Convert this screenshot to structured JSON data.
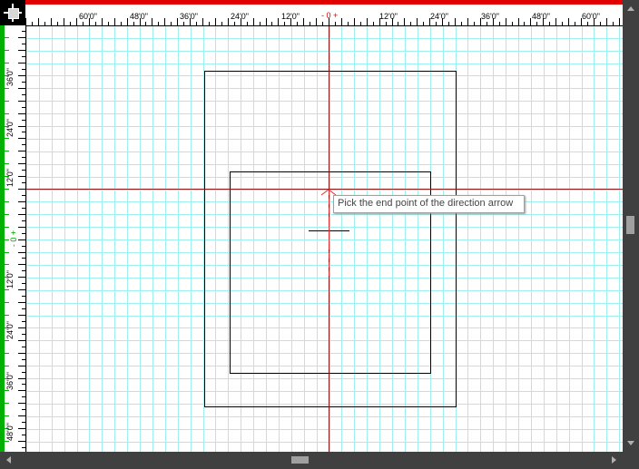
{
  "rulers": {
    "horizontal_labels": [
      "60'0\"",
      "48'0\"",
      "36'0\"",
      "24'0\"",
      "12'0\"",
      "0",
      "12'0\"",
      "24'0\"",
      "36'0\"",
      "48'0\"",
      "60'0\""
    ],
    "vertical_labels": [
      "36'0\"",
      "24'0\"",
      "12'0\"",
      "0",
      "12'0\"",
      "24'0\"",
      "36'0\"",
      "48'0\""
    ],
    "origin_label": "0"
  },
  "tooltip": {
    "text": "Pick the end point of the direction arrow"
  },
  "colors": {
    "grid": "#9ef0f0",
    "crosshair": "#8b1a1a",
    "horizontal_ruler_accent": "#e00000",
    "vertical_ruler_accent": "#00b000",
    "drawing": "#000000"
  },
  "icons": {
    "corner": "origin-crosshair-icon",
    "scroll_up": "arrow-up-icon",
    "scroll_down": "arrow-down-icon",
    "scroll_left": "arrow-left-icon",
    "scroll_right": "arrow-right-icon"
  }
}
